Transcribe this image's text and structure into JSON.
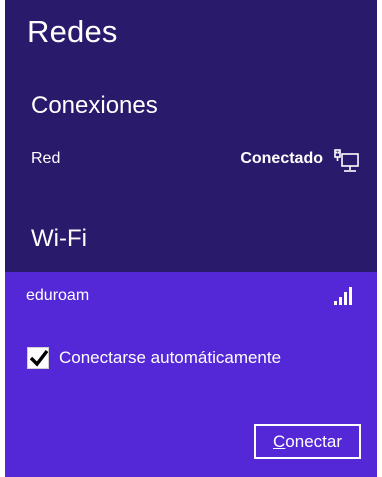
{
  "panel": {
    "title": "Redes",
    "bg_color": "#2a1a6b",
    "selected_bg_color": "#5428d6"
  },
  "connections": {
    "heading": "Conexiones",
    "items": [
      {
        "name": "Red",
        "status": "Conectado",
        "icon": "wired-network-icon"
      }
    ]
  },
  "wifi": {
    "heading": "Wi-Fi",
    "selected": {
      "name": "eduroam",
      "icon": "signal-strength-icon",
      "auto_connect_label": "Conectarse automáticamente",
      "auto_connect_checked": true,
      "connect_button_accel": "C",
      "connect_button_rest": "onectar"
    }
  }
}
